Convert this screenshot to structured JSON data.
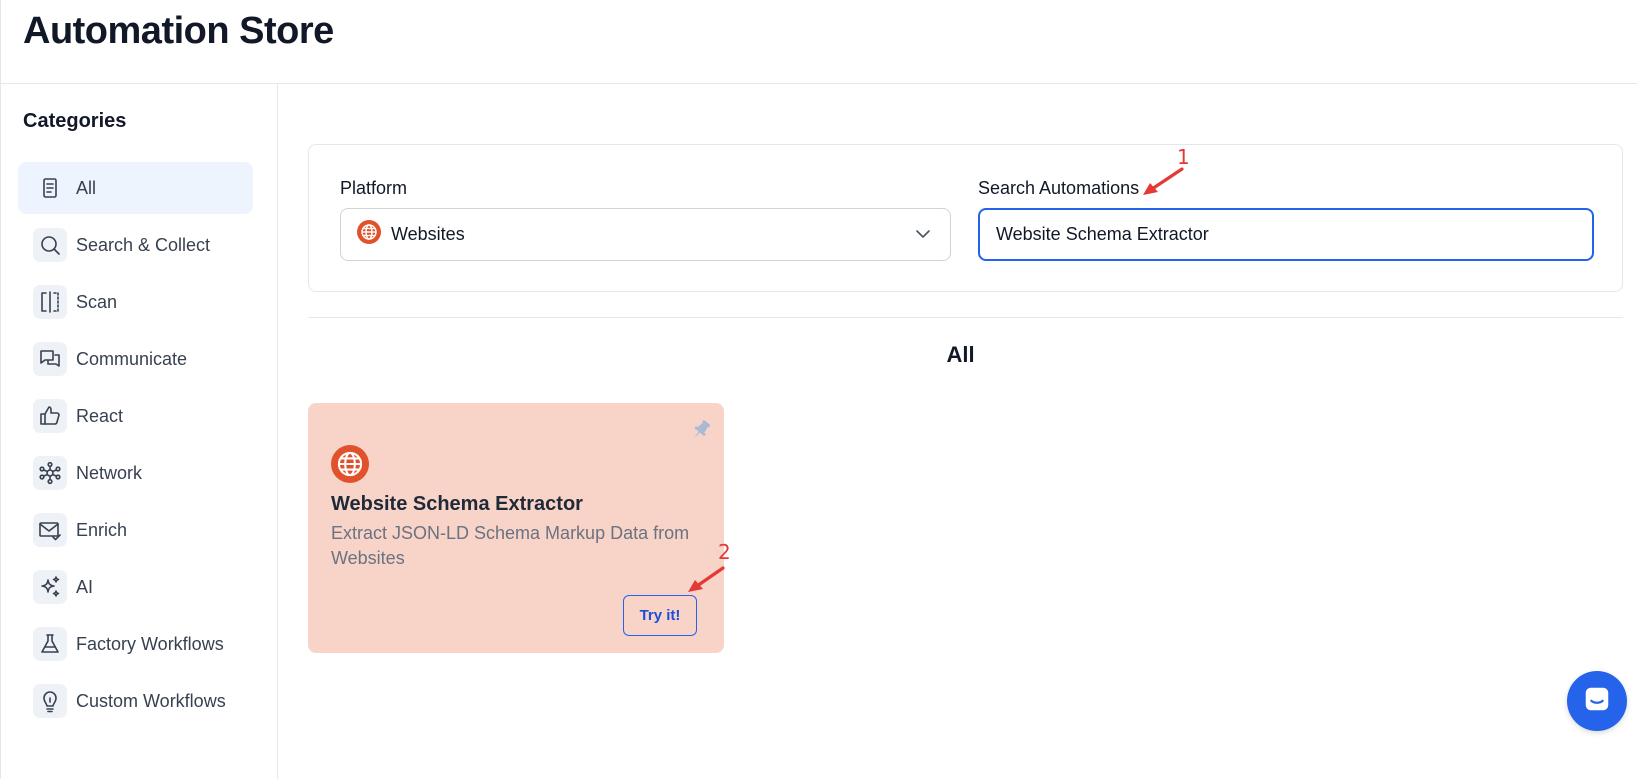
{
  "header": {
    "title": "Automation Store"
  },
  "sidebar": {
    "title": "Categories",
    "items": [
      {
        "label": "All",
        "icon": "document-icon",
        "active": true
      },
      {
        "label": "Search & Collect",
        "icon": "search-icon"
      },
      {
        "label": "Scan",
        "icon": "scan-icon"
      },
      {
        "label": "Communicate",
        "icon": "chat-bubbles-icon"
      },
      {
        "label": "React",
        "icon": "thumbs-up-icon"
      },
      {
        "label": "Network",
        "icon": "network-icon"
      },
      {
        "label": "Enrich",
        "icon": "mail-check-icon"
      },
      {
        "label": "AI",
        "icon": "sparkles-icon"
      },
      {
        "label": "Factory Workflows",
        "icon": "flask-icon"
      },
      {
        "label": "Custom Workflows",
        "icon": "lightbulb-icon"
      }
    ]
  },
  "filters": {
    "platform_label": "Platform",
    "platform_value": "Websites",
    "search_label": "Search Automations",
    "search_value": "Website Schema Extractor"
  },
  "results": {
    "section_title": "All",
    "cards": [
      {
        "title": "Website Schema Extractor",
        "description": "Extract JSON-LD Schema Markup Data from Websites",
        "button_label": "Try it!",
        "icon": "globe-icon"
      }
    ]
  },
  "annotations": {
    "marker_1": "1",
    "marker_2": "2"
  },
  "colors": {
    "accent": "#2563eb",
    "card_bg": "#f8d3c8",
    "globe": "#e0522b",
    "annotation": "#e53935",
    "active_item_bg": "#eef4fd"
  }
}
